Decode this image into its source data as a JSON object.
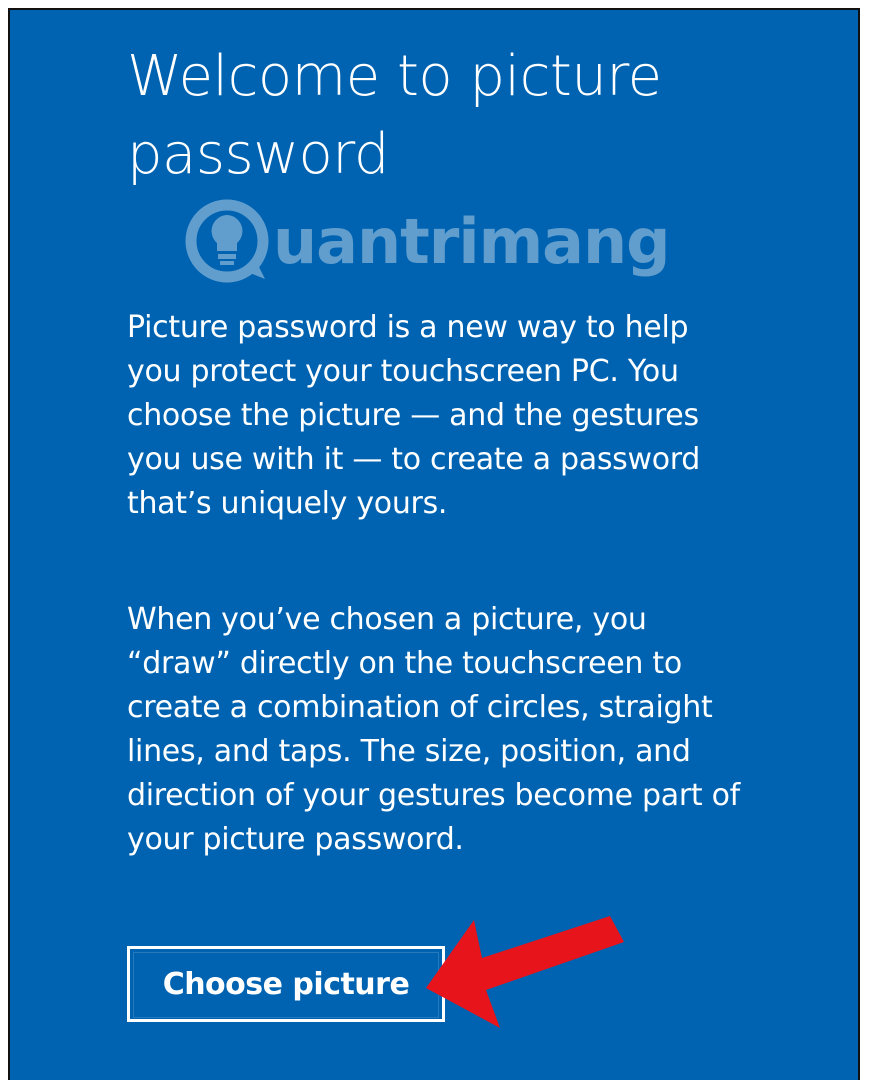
{
  "dialog": {
    "title": "Welcome to picture password",
    "paragraph1": "Picture password is a new way to help you protect your touchscreen PC. You choose the picture — and the gestures you use with it — to create a password that’s uniquely yours.",
    "paragraph2": "When you’ve chosen a picture, you “draw” directly on the touchscreen to create a combination of circles, straight lines, and taps. The size, position, and direction of your gestures become part of your picture password.",
    "choose_button_label": "Choose picture"
  },
  "watermark": {
    "text": "uantrimang",
    "icon": "lightbulb-logo-icon"
  },
  "annotation": {
    "icon": "red-arrow-icon",
    "color": "#e8141b"
  },
  "colors": {
    "background": "#0063b1",
    "text": "#ffffff"
  }
}
